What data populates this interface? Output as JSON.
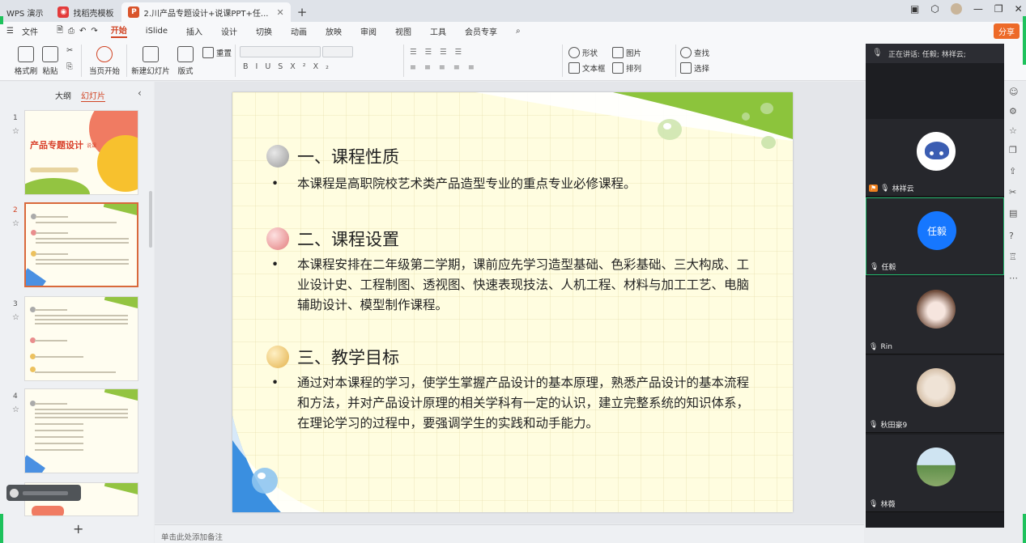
{
  "titlebar": {
    "tabs": [
      {
        "label": "WPS 演示",
        "icon": "wps-icon"
      },
      {
        "label": "找稻壳模板",
        "icon": "docer-icon"
      },
      {
        "label": "2.川产品专题设计+说课PPT+任...",
        "icon": "ppt-file-icon"
      }
    ],
    "new_tab": "+"
  },
  "menu": {
    "file": "文件",
    "items": [
      "开始",
      "iSlide",
      "插入",
      "设计",
      "切换",
      "动画",
      "放映",
      "审阅",
      "视图",
      "工具",
      "会员专享"
    ],
    "active": "开始",
    "share": "分享"
  },
  "ribbon": {
    "format_painter": "格式刷",
    "paste": "粘贴",
    "from_current": "当页开始",
    "new_slide": "新建幻灯片",
    "layout": "版式",
    "reset": "重置",
    "shape": "形状",
    "picture": "图片",
    "textbox": "文本框",
    "arrange": "排列",
    "find": "查找",
    "select": "选择"
  },
  "left_panel": {
    "tab_outline": "大纲",
    "tab_slides": "幻灯片",
    "selected_slide": 2,
    "thumbs": [
      {
        "num": "1",
        "title": "产品专题设计",
        "subtitle": "说课"
      },
      {
        "num": "2",
        "title": ""
      },
      {
        "num": "3",
        "title": ""
      },
      {
        "num": "4",
        "title": ""
      }
    ],
    "add": "+"
  },
  "slide": {
    "sections": [
      {
        "title": "一、课程性质",
        "body": "本课程是高职院校艺术类产品造型专业的重点专业必修课程。",
        "ball_color": "#a9a9a9"
      },
      {
        "title": "二、课程设置",
        "body": "本课程安排在二年级第二学期，课前应先学习造型基础、色彩基础、三大构成、工业设计史、工程制图、透视图、快速表现技法、人机工程、材料与加工工艺、电脑辅助设计、模型制作课程。",
        "ball_color": "#e98d8d"
      },
      {
        "title": "三、教学目标",
        "body": "通过对本课程的学习，使学生掌握产品设计的基本原理，熟悉产品设计的基本流程和方法，并对产品设计原理的相关学科有一定的认识，建立完整系统的知识体系，在理论学习的过程中，要强调学生的实践和动手能力。",
        "ball_color": "#ecc15e"
      }
    ],
    "bullet": "•"
  },
  "notes_placeholder": "单击此处添加备注",
  "meeting": {
    "speaking": "正在讲话: 任毅; 林祥云;",
    "participants": [
      {
        "name": "林祥云",
        "avatar": "cartoon"
      },
      {
        "name": "任毅",
        "avatar_text": "任毅"
      },
      {
        "name": "Rin",
        "avatar": "dog"
      },
      {
        "name": "秋田豪9",
        "avatar": "cat"
      },
      {
        "name": "林薇",
        "avatar": "landscape"
      }
    ]
  },
  "colors": {
    "accent": "#d14424",
    "share_bg": "#ed6a28",
    "active_speaker_border": "#21b46b",
    "avatar_blue": "#1677ff"
  }
}
